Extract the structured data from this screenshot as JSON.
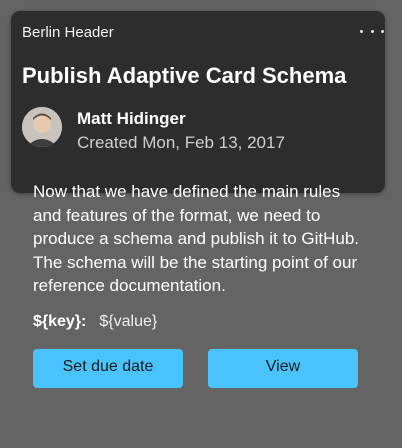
{
  "card": {
    "header_label": "Berlin Header",
    "title": "Publish Adaptive Card Schema",
    "author": "Matt Hidinger",
    "created": "Created Mon, Feb 13, 2017",
    "body": "Now that we have defined the main rules and features of the format, we need to produce a schema and publish it to GitHub. The schema will be the starting point of our reference documentation.",
    "fact": {
      "key": "${key}:",
      "value": "${value}"
    },
    "actions": {
      "due_date": "Set due date",
      "view": "View"
    }
  },
  "icons": {
    "more": "more-horizontal-icon",
    "avatar": "user-avatar"
  },
  "colors": {
    "background": "#646464",
    "header_card": "#2d2d2d",
    "accent": "#4ac3fc"
  }
}
